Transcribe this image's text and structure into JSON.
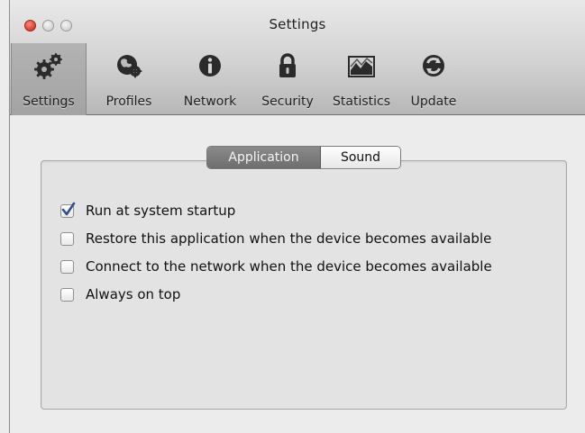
{
  "window": {
    "title": "Settings"
  },
  "toolbar": {
    "items": [
      {
        "label": "Settings",
        "icon": "settings-gears-icon",
        "active": true
      },
      {
        "label": "Profiles",
        "icon": "profiles-globe-icon",
        "active": false
      },
      {
        "label": "Network",
        "icon": "info-icon",
        "active": false
      },
      {
        "label": "Security",
        "icon": "lock-icon",
        "active": false
      },
      {
        "label": "Statistics",
        "icon": "chart-icon",
        "active": false
      },
      {
        "label": "Update",
        "icon": "update-refresh-icon",
        "active": false
      }
    ]
  },
  "tabs": {
    "items": [
      {
        "label": "Application",
        "selected": true
      },
      {
        "label": "Sound",
        "selected": false
      }
    ]
  },
  "options": [
    {
      "label": "Run at system startup",
      "checked": true
    },
    {
      "label": "Restore this application when the device becomes available",
      "checked": false
    },
    {
      "label": "Connect to the network when the device becomes available",
      "checked": false
    },
    {
      "label": "Always on top",
      "checked": false
    }
  ],
  "colors": {
    "checkmark": "#2f4f8f",
    "close_button": "#e0443a",
    "active_tab": "#7a7a7a"
  }
}
